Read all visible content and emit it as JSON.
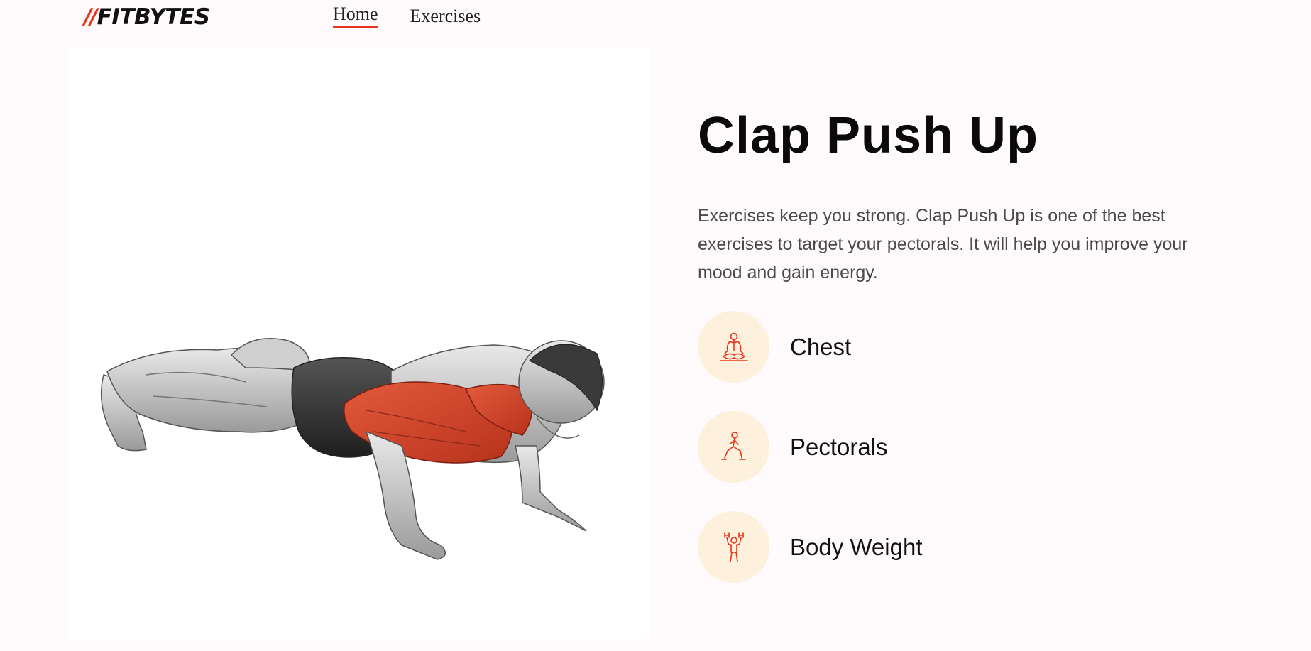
{
  "header": {
    "logo_slashes": "//",
    "logo_text": "FITBYTES",
    "nav": {
      "home_label": "Home",
      "exercises_label": "Exercises"
    }
  },
  "exercise": {
    "image_alt": "Clap Push Up",
    "title": "Clap Push Up",
    "description": "Exercises keep you strong. Clap Push Up is one of the best exercises to target your pectorals. It will help you improve your mood and gain energy.",
    "tags": [
      {
        "label": "Chest",
        "icon": "meditation-icon"
      },
      {
        "label": "Pectorals",
        "icon": "lunge-icon"
      },
      {
        "label": "Body Weight",
        "icon": "dumbbell-lift-icon"
      }
    ]
  },
  "colors": {
    "accent": "#e8341c",
    "background": "#fffafb",
    "tag_circle": "#fdf0dc",
    "muscle_highlight": "#d9452a"
  }
}
